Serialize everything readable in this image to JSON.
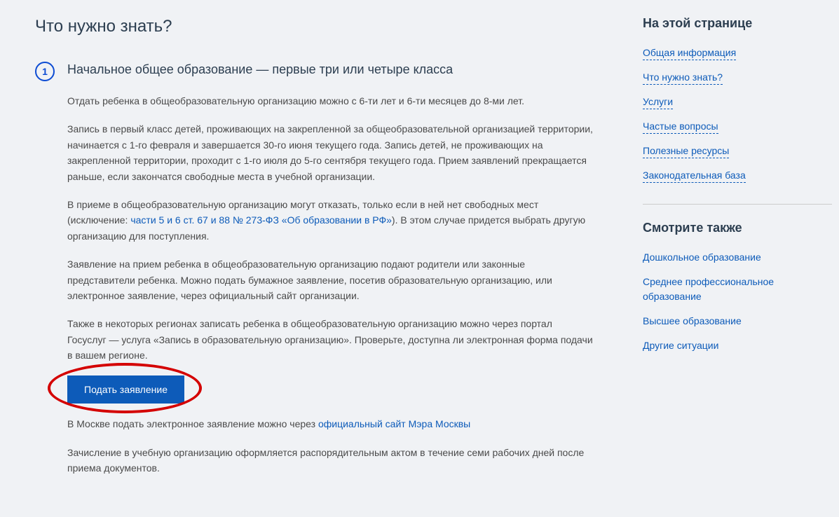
{
  "main": {
    "title": "Что нужно знать?",
    "section": {
      "number": "1",
      "heading": "Начальное общее образование — первые три или четыре класса",
      "para1": "Отдать ребенка в общеобразовательную организацию можно с 6-ти лет и 6-ти месяцев до 8-ми лет.",
      "para2": "Запись в первый класс детей, проживающих на закрепленной за общеобразовательной организацией территории, начинается с 1-го февраля и завершается 30-го июня текущего года. Запись детей, не проживающих на закрепленной территории, проходит с 1-го июля до 5-го сентября текущего года. Прием заявлений прекращается раньше, если закончатся свободные места в учебной организации.",
      "para3a": "В приеме в общеобразовательную организацию могут отказать, только если в ней нет свободных мест (исключение: ",
      "para3_link": "части 5 и 6 ст. 67 и 88 № 273-ФЗ «Об образовании в РФ»",
      "para3b": "). В этом случае придется выбрать другую организацию для поступления.",
      "para4": "Заявление на прием ребенка в общеобразовательную организацию подают родители или законные представители ребенка. Можно подать бумажное заявление, посетив образовательную организацию, или электронное заявление, через официальный сайт организации.",
      "para5": "Также в некоторых регионах записать ребенка в общеобразовательную организацию можно через портал Госуслуг — услуга «Запись в образовательную организацию». Проверьте, доступна ли электронная форма подачи в вашем регионе.",
      "button": "Подать заявление",
      "para6a": "В Москве подать электронное заявление можно через ",
      "para6_link": "официальный сайт Мэра Москвы",
      "para7": "Зачисление в учебную организацию оформляется распорядительным актом в течение семи рабочих дней после приема документов."
    }
  },
  "sidebar": {
    "onThisPage": {
      "title": "На этой странице",
      "links": [
        "Общая информация",
        "Что нужно знать?",
        "Услуги",
        "Частые вопросы",
        "Полезные ресурсы",
        "Законодательная база"
      ]
    },
    "seeAlso": {
      "title": "Смотрите также",
      "links": [
        "Дошкольное образование",
        "Среднее профессиональное образование",
        "Высшее образование",
        "Другие ситуации"
      ]
    }
  }
}
